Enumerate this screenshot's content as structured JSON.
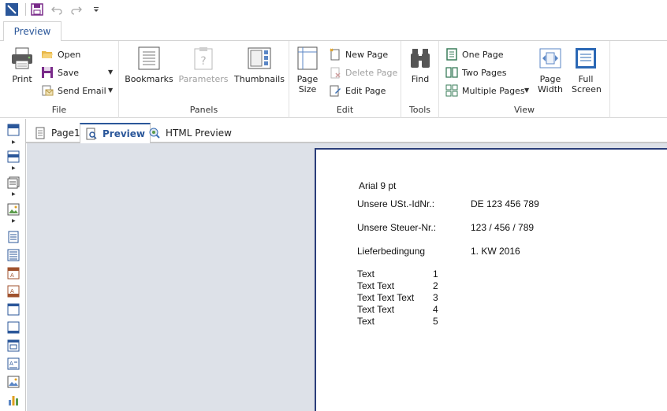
{
  "ribbon": {
    "tab": "Preview",
    "groups": {
      "file": {
        "label": "File",
        "print": "Print",
        "open": "Open",
        "save": "Save",
        "send_email": "Send Email"
      },
      "panels": {
        "label": "Panels",
        "bookmarks": "Bookmarks",
        "parameters": "Parameters",
        "thumbnails": "Thumbnails"
      },
      "edit": {
        "label": "Edit",
        "page_size": "Page Size",
        "new_page": "New Page",
        "delete_page": "Delete Page",
        "edit_page": "Edit Page"
      },
      "tools": {
        "label": "Tools",
        "find": "Find"
      },
      "view": {
        "label": "View",
        "one_page": "One Page",
        "two_pages": "Two Pages",
        "multiple_pages": "Multiple Pages",
        "page_width": "Page Width",
        "full_screen": "Full Screen"
      }
    }
  },
  "doc_tabs": [
    {
      "label": "Page1",
      "active": false
    },
    {
      "label": "Preview",
      "active": true
    },
    {
      "label": "HTML Preview",
      "active": false
    }
  ],
  "page": {
    "font_label": "Arial 9 pt",
    "fields": [
      {
        "label": "Unsere USt.-IdNr.:",
        "value": "DE 123 456 789"
      },
      {
        "label": "Unsere Steuer-Nr.:",
        "value": "123 / 456 / 789"
      },
      {
        "label": "Lieferbedingung",
        "value": "1. KW 2016"
      }
    ],
    "list": [
      {
        "text": "Text",
        "num": "1"
      },
      {
        "text": "Text Text",
        "num": "2"
      },
      {
        "text": "Text Text Text",
        "num": "3"
      },
      {
        "text": "Text Text",
        "num": "4"
      },
      {
        "text": "Text",
        "num": "5"
      }
    ]
  },
  "colors": {
    "accent": "#2b579a",
    "preview_bg": "#dde1e8",
    "page_border": "#2b3e7a"
  }
}
